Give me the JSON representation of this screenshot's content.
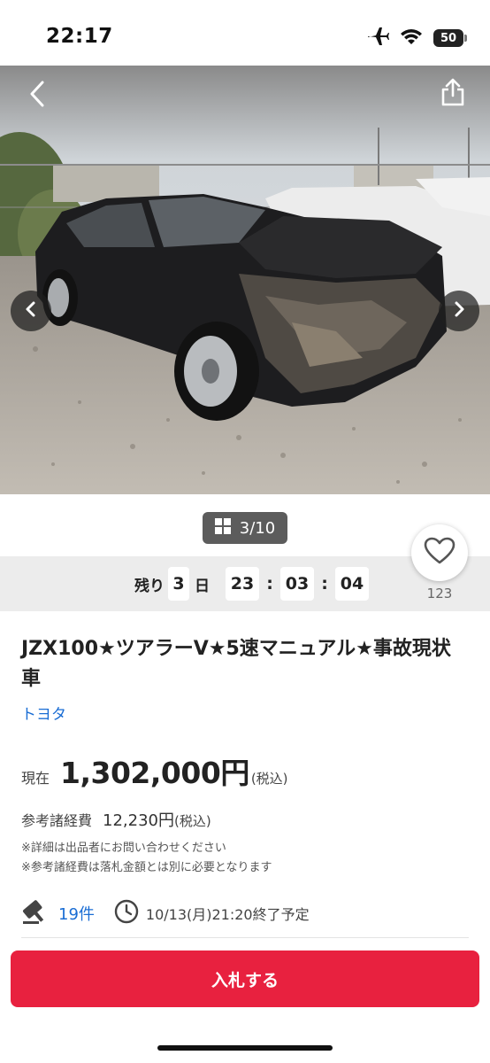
{
  "status_bar": {
    "time": "22:17",
    "battery": "50"
  },
  "gallery": {
    "counter": "3/10",
    "icons": [
      "chevron-left-icon",
      "share-icon",
      "chevron-right-icon",
      "grid-icon"
    ]
  },
  "favorite": {
    "count": "123",
    "icon": "heart-icon"
  },
  "countdown": {
    "prefix": "残り",
    "days": "3",
    "days_unit": "日",
    "hours": "23",
    "minutes": "03",
    "seconds": "04"
  },
  "listing": {
    "title": "JZX100★ツアラーV★5速マニュアル★事故現状車",
    "brand": "トヨタ",
    "price_label": "現在",
    "price": "1,302,000円",
    "price_tax": "(税込)",
    "fee_label": "参考諸経費",
    "fee_value": "12,230円",
    "fee_tax": "(税込)",
    "note1": "※詳細は出品者にお問い合わせください",
    "note2": "※参考諸経費は落札金額とは別に必要となります",
    "bids": "19件",
    "end_time": "10/13(月)21:20終了予定"
  },
  "actions": {
    "bid_label": "入札する"
  },
  "colors": {
    "accent": "#e8213f",
    "link": "#1a6dd4",
    "countdown_bg": "#ececec"
  }
}
